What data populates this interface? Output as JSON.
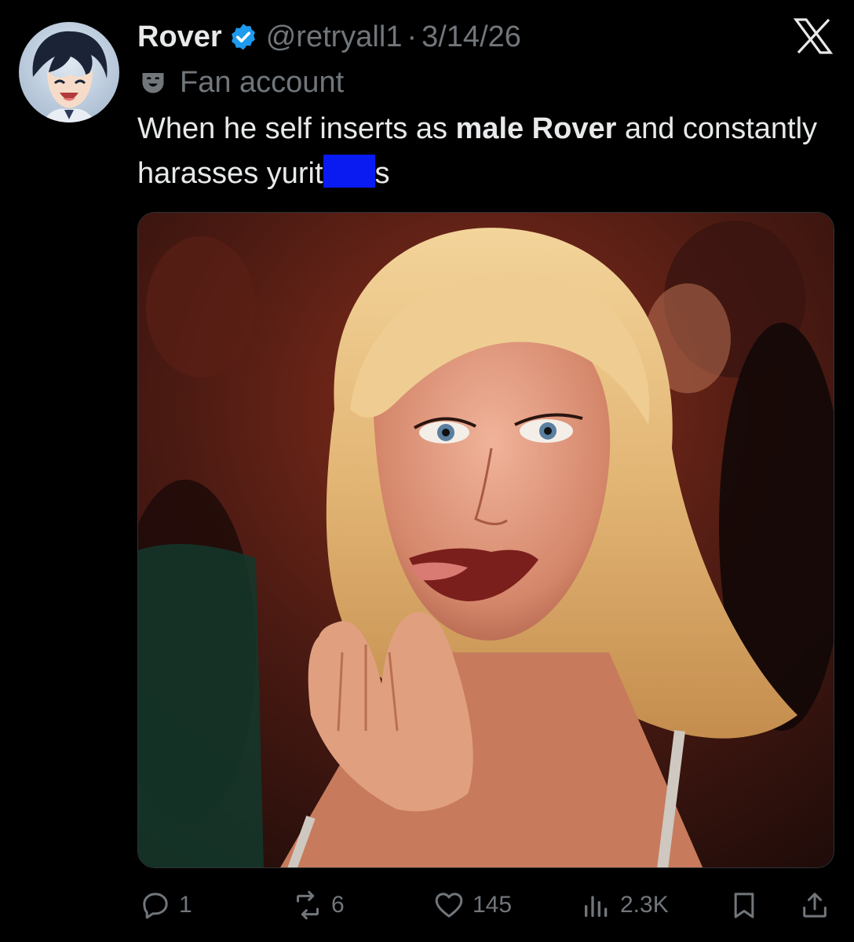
{
  "post": {
    "author": {
      "display_name": "Rover",
      "handle": "@retryall1",
      "separator": "·",
      "date": "3/14/26",
      "verified": true
    },
    "label": {
      "icon": "theater-mask-icon",
      "text": "Fan account"
    },
    "text": {
      "part1": "When he self inserts as ",
      "bold": "male Rover",
      "part2": " and constantly harasses yurit",
      "part3": "s"
    },
    "media": {
      "description_icon": "photo"
    },
    "metrics": {
      "replies": "1",
      "reposts": "6",
      "likes": "145",
      "views": "2.3K"
    }
  },
  "colors": {
    "background": "#000000",
    "text": "#e7e9ea",
    "secondary": "#71767b",
    "verified": "#1d9bf0",
    "redaction": "#0a1bf2"
  },
  "icons": {
    "brand": "x-logo-icon",
    "reply": "reply-icon",
    "repost": "repost-icon",
    "like": "heart-icon",
    "views": "views-icon",
    "bookmark": "bookmark-icon",
    "share": "share-icon"
  }
}
